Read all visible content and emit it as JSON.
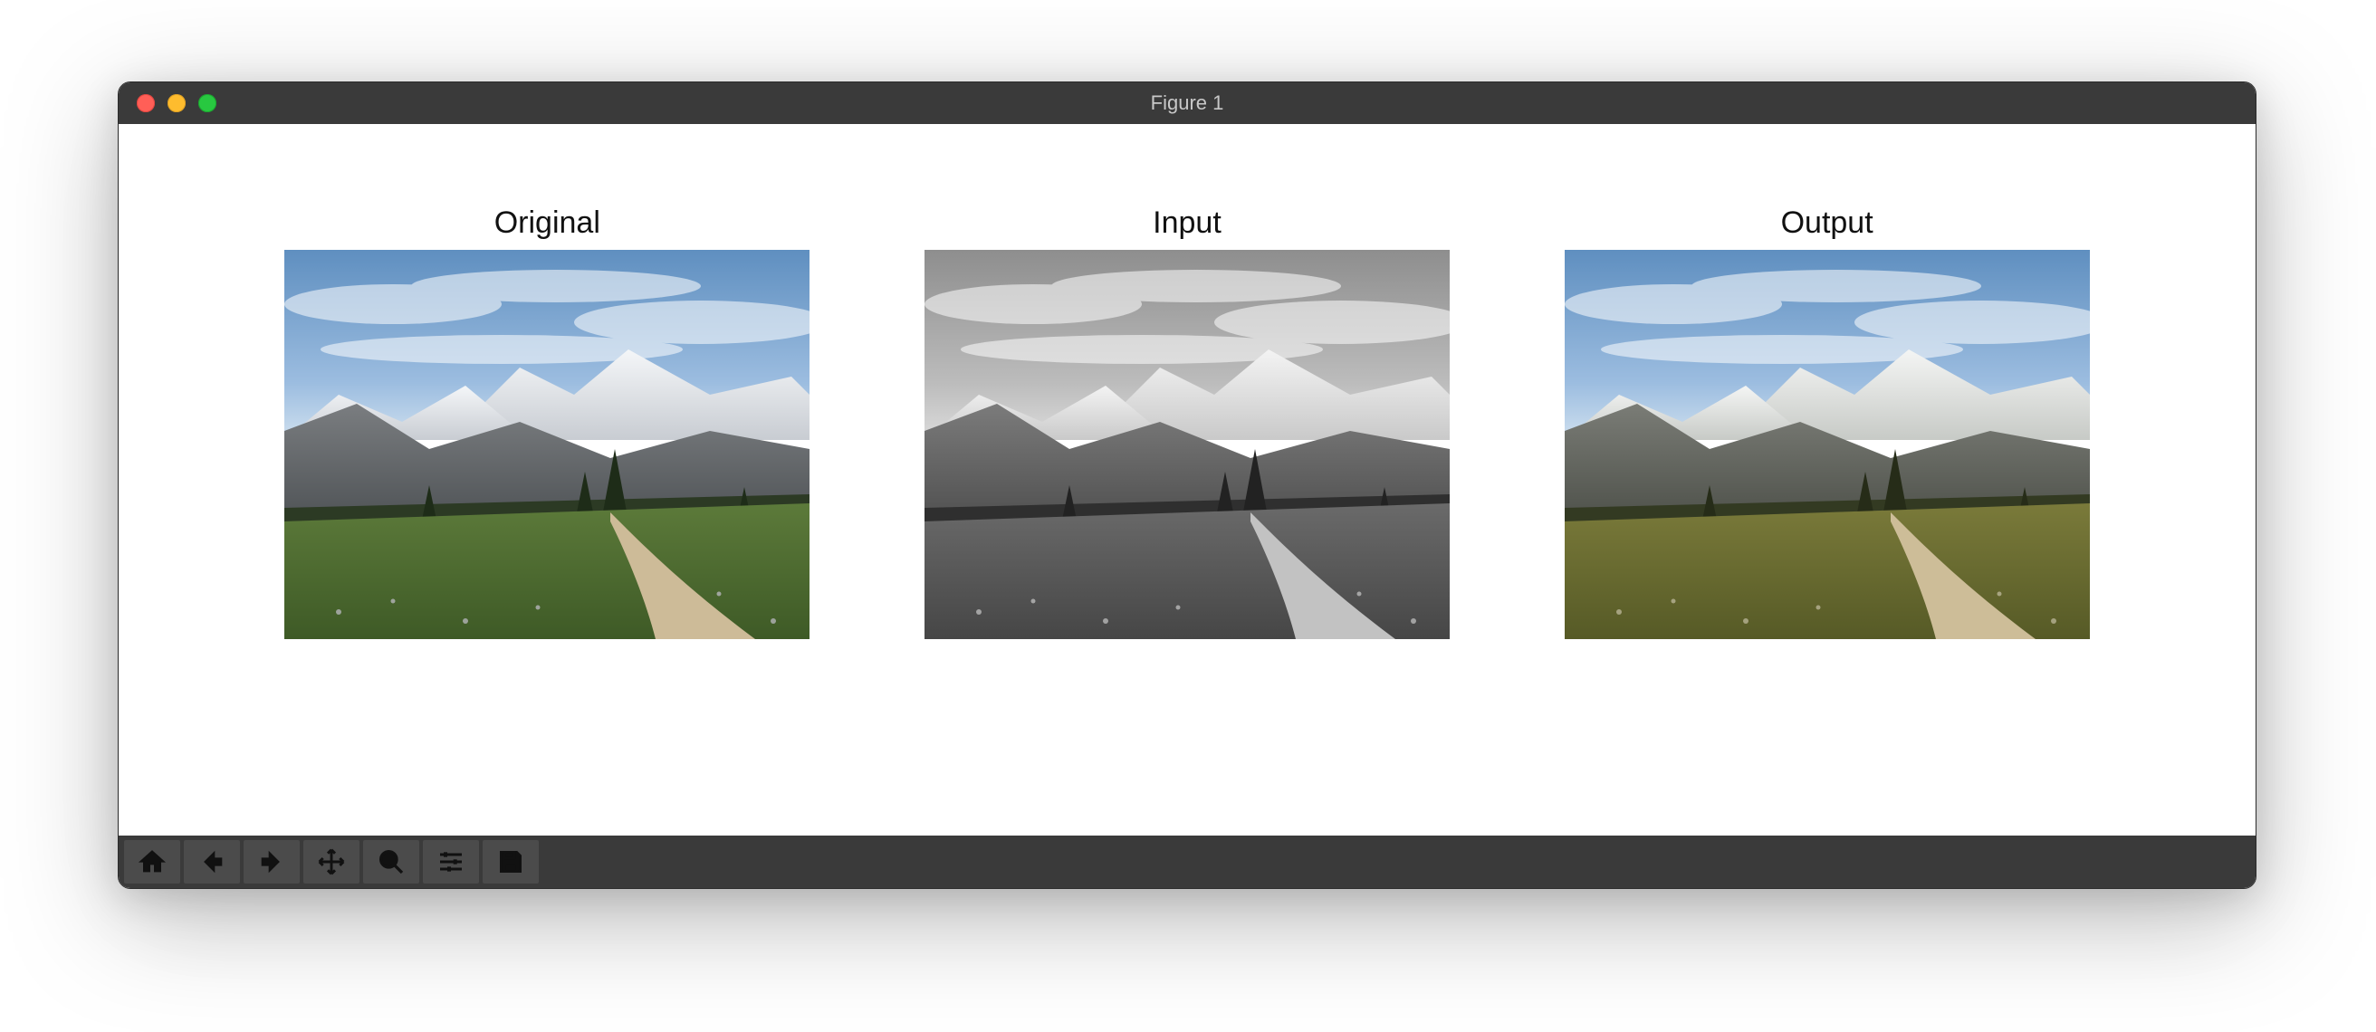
{
  "window": {
    "title": "Figure 1"
  },
  "subplots": [
    {
      "title": "Original",
      "mode": "color"
    },
    {
      "title": "Input",
      "mode": "gray"
    },
    {
      "title": "Output",
      "mode": "warm"
    }
  ],
  "toolbar": {
    "buttons": [
      {
        "name": "home",
        "icon": "home-icon"
      },
      {
        "name": "back",
        "icon": "arrow-left-icon"
      },
      {
        "name": "forward",
        "icon": "arrow-right-icon"
      },
      {
        "name": "pan",
        "icon": "move-icon"
      },
      {
        "name": "zoom",
        "icon": "magnify-icon"
      },
      {
        "name": "configure",
        "icon": "sliders-icon"
      },
      {
        "name": "save",
        "icon": "save-icon"
      }
    ]
  }
}
